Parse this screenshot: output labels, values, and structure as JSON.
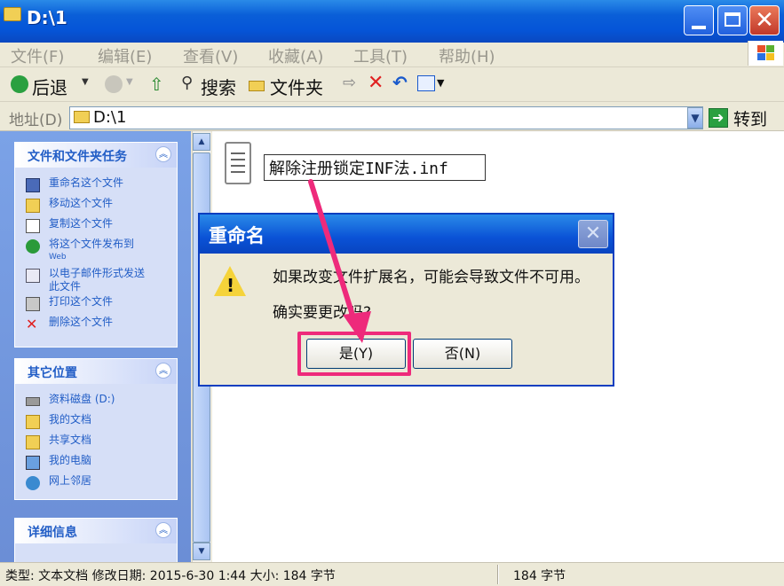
{
  "window": {
    "title": "D:\\1"
  },
  "menu": [
    "文件(F)",
    "编辑(E)",
    "查看(V)",
    "收藏(A)",
    "工具(T)",
    "帮助(H)"
  ],
  "toolbar": {
    "back": "后退",
    "search": "搜索",
    "folders": "文件夹"
  },
  "address": {
    "label": "地址(D)",
    "value": "D:\\1",
    "go": "转到"
  },
  "left_pane": {
    "tasks": {
      "title": "文件和文件夹任务",
      "items": [
        {
          "label": "重命名这个文件",
          "icon": "rename-icon"
        },
        {
          "label": "移动这个文件",
          "icon": "move-icon"
        },
        {
          "label": "复制这个文件",
          "icon": "copy-icon"
        },
        {
          "label": "将这个文件发布到",
          "label2": "Web",
          "icon": "globe-icon"
        },
        {
          "label": "以电子邮件形式发送",
          "label2": "此文件",
          "icon": "email-icon"
        },
        {
          "label": "打印这个文件",
          "icon": "print-icon"
        },
        {
          "label": "删除这个文件",
          "icon": "delete-icon"
        }
      ]
    },
    "places": {
      "title": "其它位置",
      "items": [
        {
          "label": "资料磁盘 (D:)",
          "icon": "drive-icon"
        },
        {
          "label": "我的文档",
          "icon": "my-documents-icon"
        },
        {
          "label": "共享文档",
          "icon": "shared-folder-icon"
        },
        {
          "label": "我的电脑",
          "icon": "my-computer-icon"
        },
        {
          "label": "网上邻居",
          "icon": "network-icon"
        }
      ]
    },
    "details": {
      "title": "详细信息"
    }
  },
  "file": {
    "name": "解除注册锁定INF法.inf"
  },
  "dialog": {
    "title": "重命名",
    "message1": "如果改变文件扩展名，可能会导致文件不可用。",
    "message2": "确实要更改吗?",
    "yes": "是(Y)",
    "no": "否(N)"
  },
  "status": {
    "main": "类型: 文本文档 修改日期: 2015-6-30 1:44 大小: 184 字节",
    "size": "184 字节"
  },
  "colors": {
    "highlight": "#ee2a7b",
    "titlebar": "#0a5fd8",
    "link": "#215dc6"
  }
}
